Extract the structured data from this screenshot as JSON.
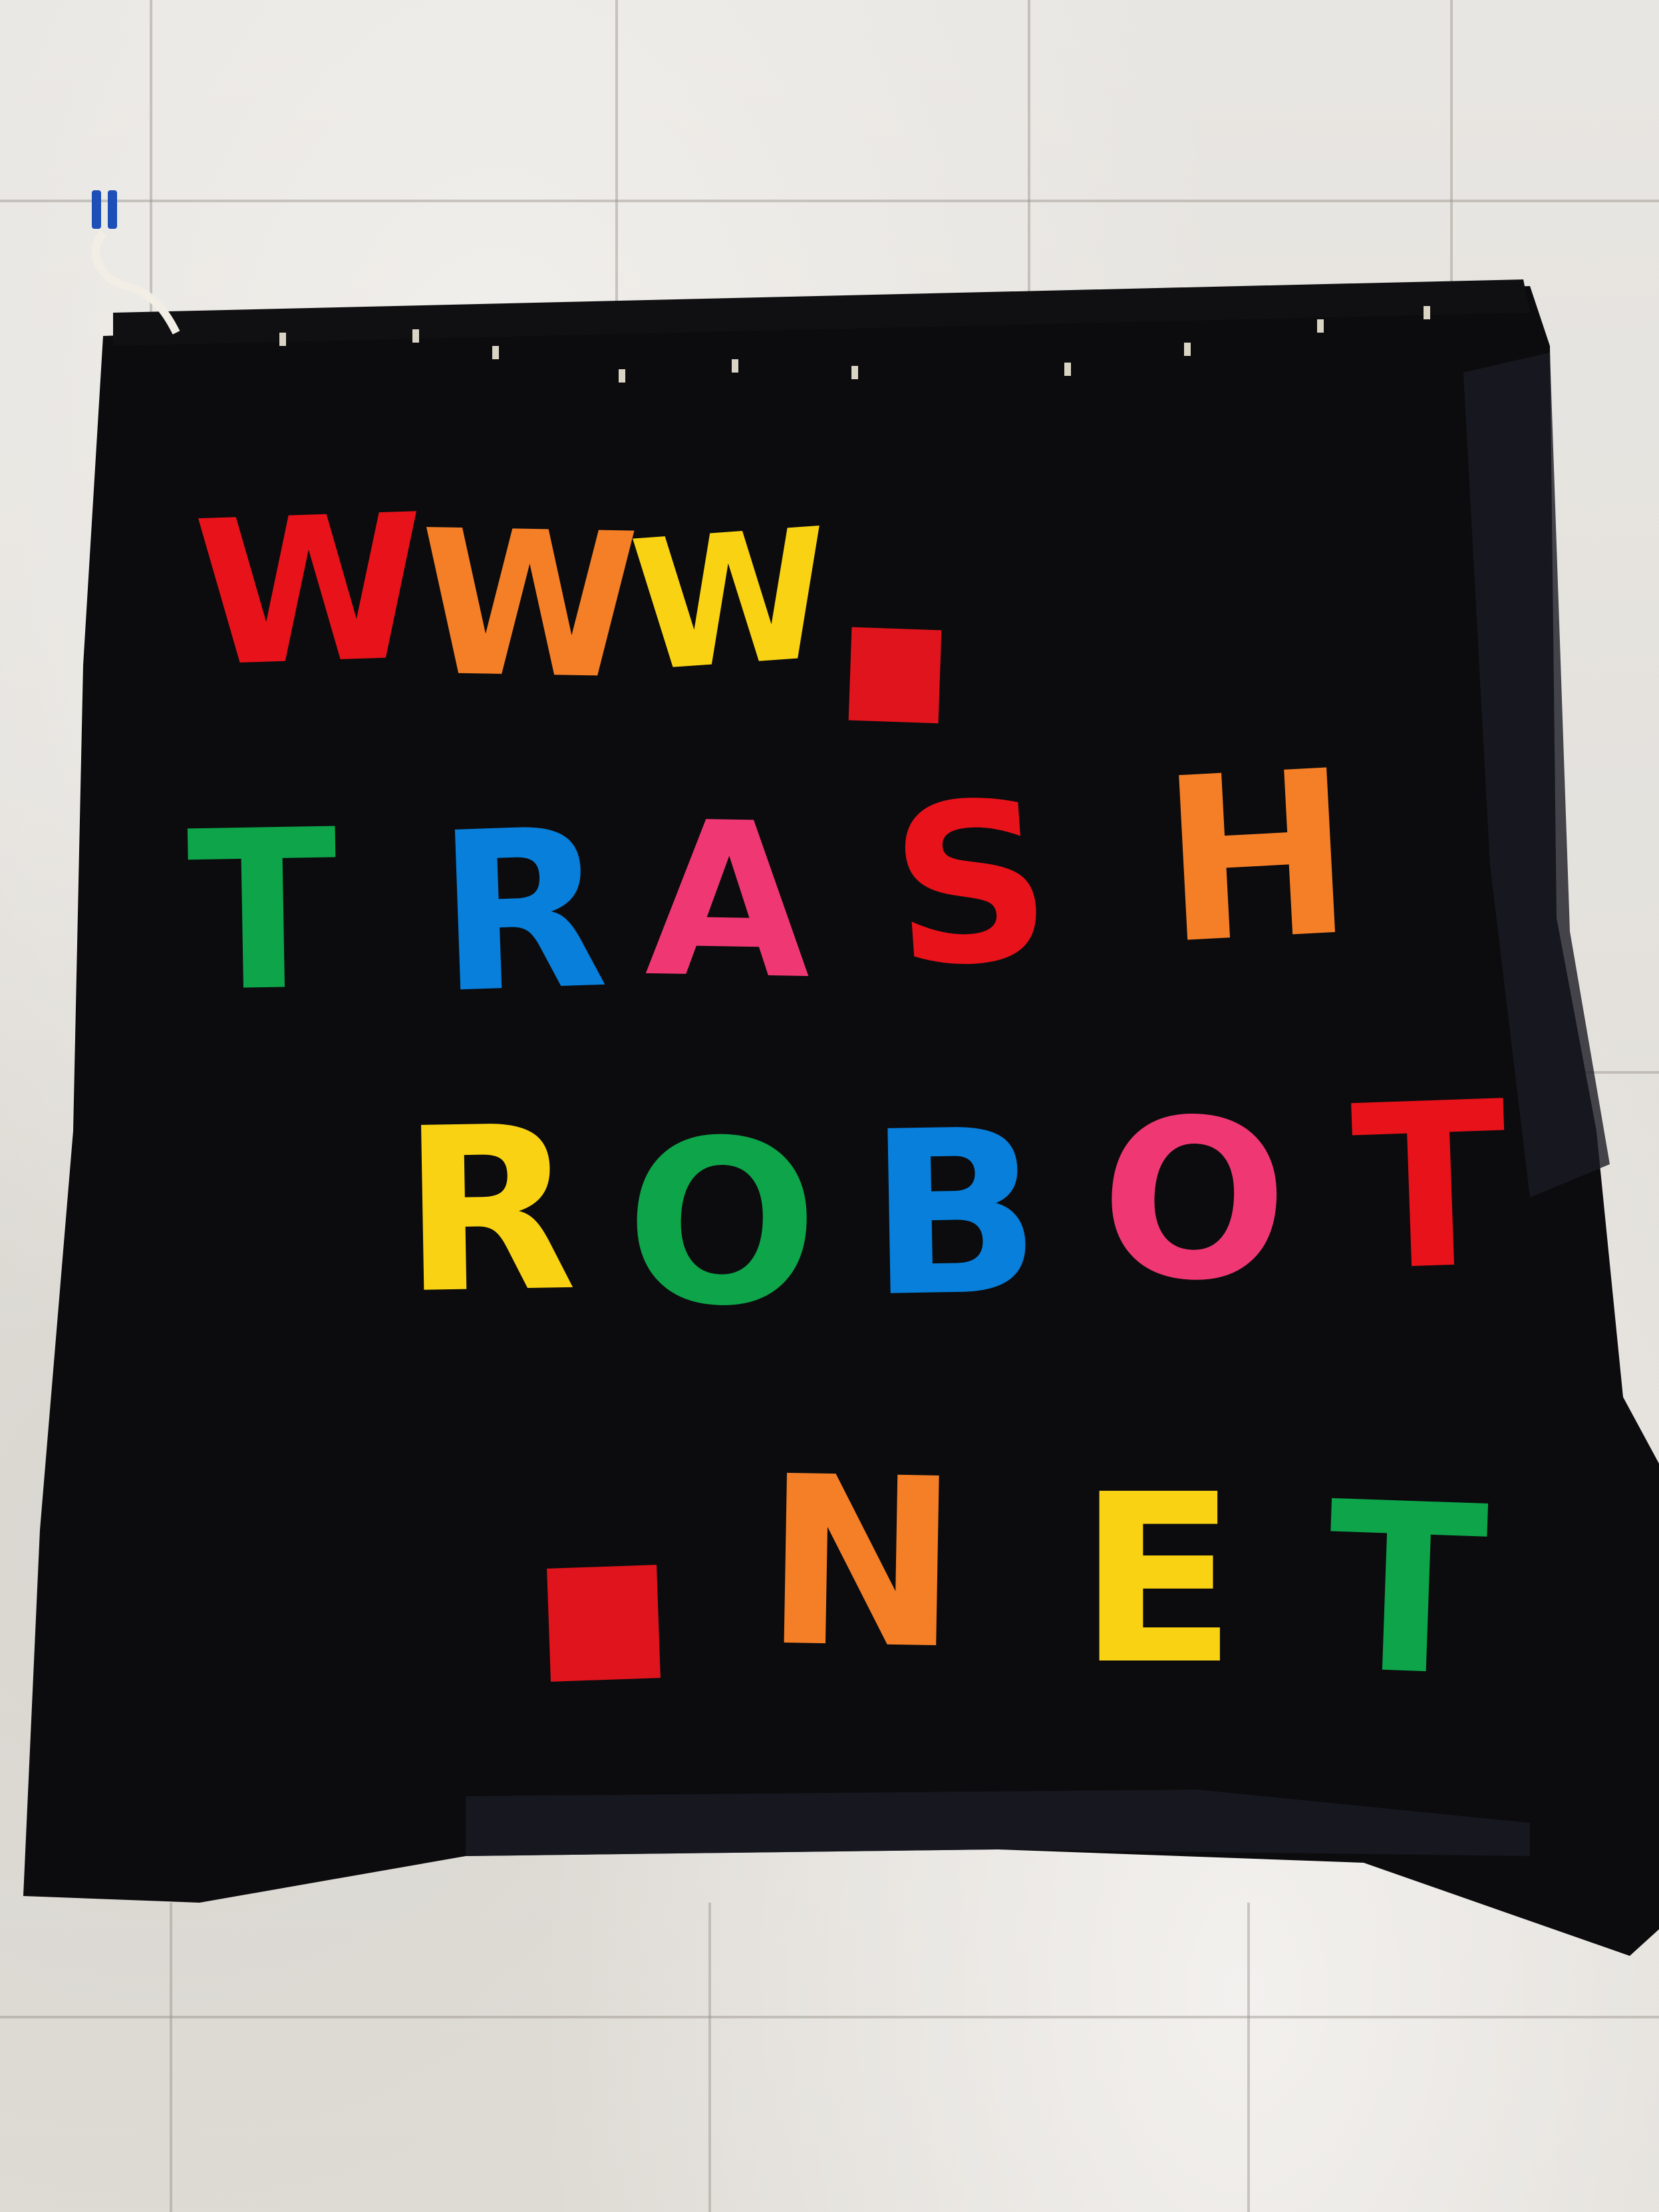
{
  "banner": {
    "line1": [
      "W",
      "W",
      "W",
      "."
    ],
    "line2": [
      "T",
      "R",
      "A",
      "S",
      "H"
    ],
    "line3": [
      "R",
      "O",
      "B",
      "O",
      "T"
    ],
    "line4": [
      ".",
      "N",
      "E",
      "T"
    ]
  },
  "colors": {
    "red": "#e0141c",
    "orange": "#f0802c",
    "yellow": "#f6d21c",
    "green": "#12a24c",
    "blue": "#0c7ed6",
    "pink": "#e83a72",
    "cloth": "#0c0c0e",
    "quilt": "#e4e1dc",
    "clip": "#1d4fb8"
  }
}
